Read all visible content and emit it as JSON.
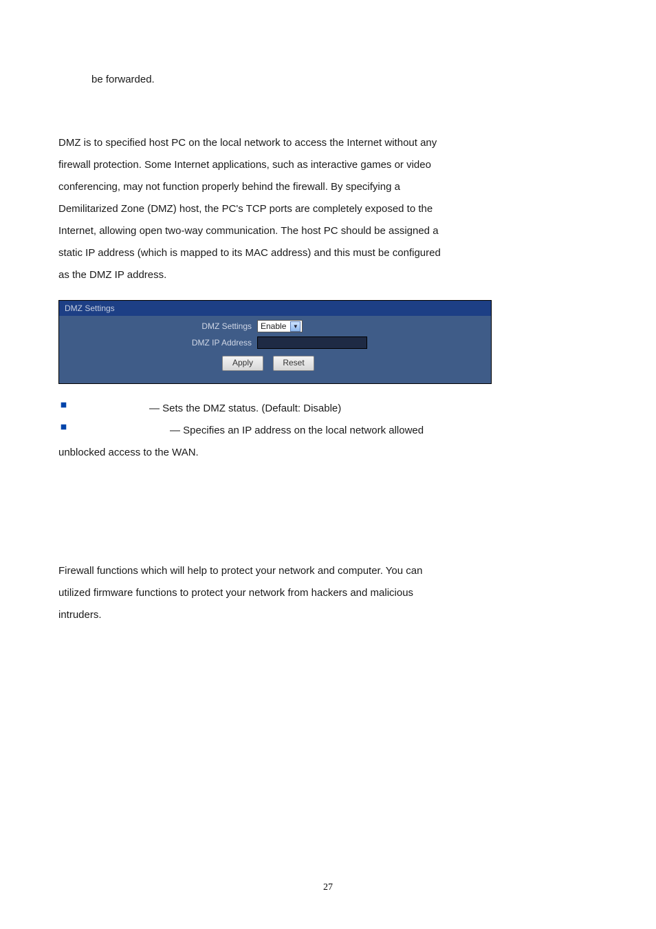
{
  "top_line": "be forwarded.",
  "para1": {
    "l1": "DMZ is to specified host PC on the local network to access the Internet without any",
    "l2": "firewall protection. Some Internet applications, such as interactive games or video",
    "l3": "conferencing, may not function properly behind the firewall. By specifying a",
    "l4": "Demilitarized Zone (DMZ) host, the PC's TCP ports are completely exposed to the",
    "l5": "Internet, allowing open two-way communication. The host PC should be assigned a",
    "l6": "static IP address (which is mapped to its MAC address) and this must be configured",
    "l7": "as the DMZ IP address."
  },
  "panel": {
    "title": "DMZ Settings",
    "row1_label": "DMZ Settings",
    "row1_value": "Enable",
    "row2_label": "DMZ IP Address",
    "row2_value": "",
    "btn_apply": "Apply",
    "btn_reset": "Reset"
  },
  "bullets": {
    "b1": "— Sets the DMZ status. (Default: Disable)",
    "b2": "— Specifies an IP address on the local network allowed"
  },
  "post_line": "unblocked access to the WAN.",
  "para2": {
    "l1": "Firewall functions which will help to protect your network and computer. You can",
    "l2": "utilized firmware functions to protect your network from hackers and malicious",
    "l3": "intruders."
  },
  "page_number": "27"
}
